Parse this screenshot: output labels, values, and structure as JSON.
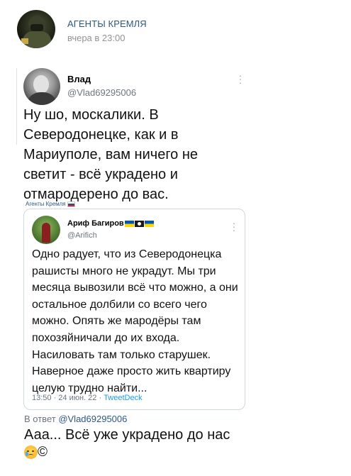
{
  "post": {
    "group_name": "АГЕНТЫ КРЕМЛЯ",
    "time": "вчера в 23:00"
  },
  "tweet": {
    "author_name": "Влад",
    "author_handle": "@Vlad69295006",
    "text": "Ну шо, москалики. В Северодонецке, как и в Мариуполе, вам ничего не светит - всё украдено и отмародерено до вас.",
    "source_tag": "Агенты Кремля"
  },
  "quoted_tweet": {
    "author_name": "Ариф Багиров",
    "author_handle": "@Arifich",
    "text": "Одно радует, что из Северодонецка рашисты много не украдут. Мы три месяца вывозили всё что можно, а они остальное долбили со всего чего можно. Опять же мародёры там похозяйничали до их входа. Насиловать там только старушек. Наверное даже просто жить квартиру целую трудно найти...",
    "meta": "13:50 · 24 июн. 22 · ",
    "client": "TweetDeck"
  },
  "reply": {
    "prefix": "В ответ ",
    "to_handle": "@Vlad69295006",
    "text": "Ааа... Всё уже украдено до нас",
    "suffix": "©"
  },
  "icons": {
    "more": "more-vertical-icon",
    "flags": [
      "ukraine-flag-icon",
      "pirate-flag-icon",
      "ukraine-flag-icon"
    ],
    "emoji": "crying-face-emoji"
  }
}
